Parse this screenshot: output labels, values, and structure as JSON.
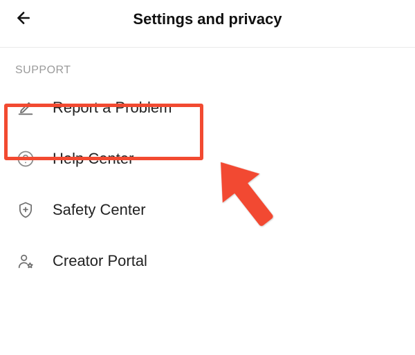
{
  "header": {
    "title": "Settings and privacy"
  },
  "section_label": "SUPPORT",
  "menu": {
    "items": [
      {
        "label": "Report a Problem"
      },
      {
        "label": "Help Center"
      },
      {
        "label": "Safety Center"
      },
      {
        "label": "Creator Portal"
      }
    ]
  }
}
